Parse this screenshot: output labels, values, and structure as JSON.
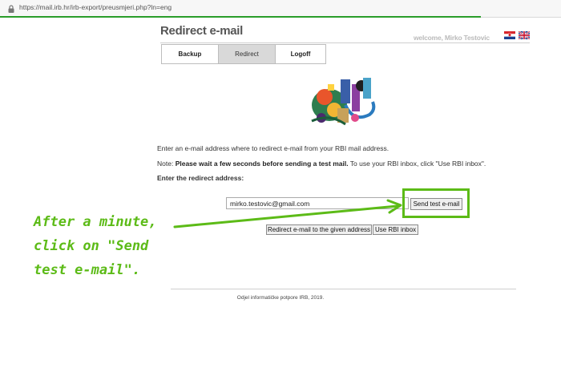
{
  "browser": {
    "url": "https://mail.irb.hr/irb-export/preusmjeri.php?ln=eng"
  },
  "header": {
    "title": "Redirect e-mail",
    "welcome": "welcome, Mirko Testovic"
  },
  "tabs": [
    {
      "label": "Backup"
    },
    {
      "label": "Redirect",
      "active": true
    },
    {
      "label": "Logoff"
    }
  ],
  "content": {
    "instruction": "Enter an e-mail address where to redirect e-mail from your RBI mail address.",
    "note_prefix": "Note: ",
    "note_bold": "Please wait a few seconds before sending a test mail.",
    "note_rest": " To use your RBI inbox, click \"Use RBI inbox\".",
    "label": "Enter the redirect address:",
    "email_value": "mirko.testovic@gmail.com",
    "send_test_label": "Send test e-mail",
    "redirect_label": "Redirect e-mail to the given address",
    "use_inbox_label": "Use RBI inbox"
  },
  "footer": {
    "text": "Odjel informatičke potpore IRB, 2019."
  },
  "annotation": {
    "text": "After a minute,\nclick on \"Send\ntest e-mail\"."
  },
  "colors": {
    "annotation": "#5cbb17",
    "active_tab": "#d9d9d9"
  }
}
